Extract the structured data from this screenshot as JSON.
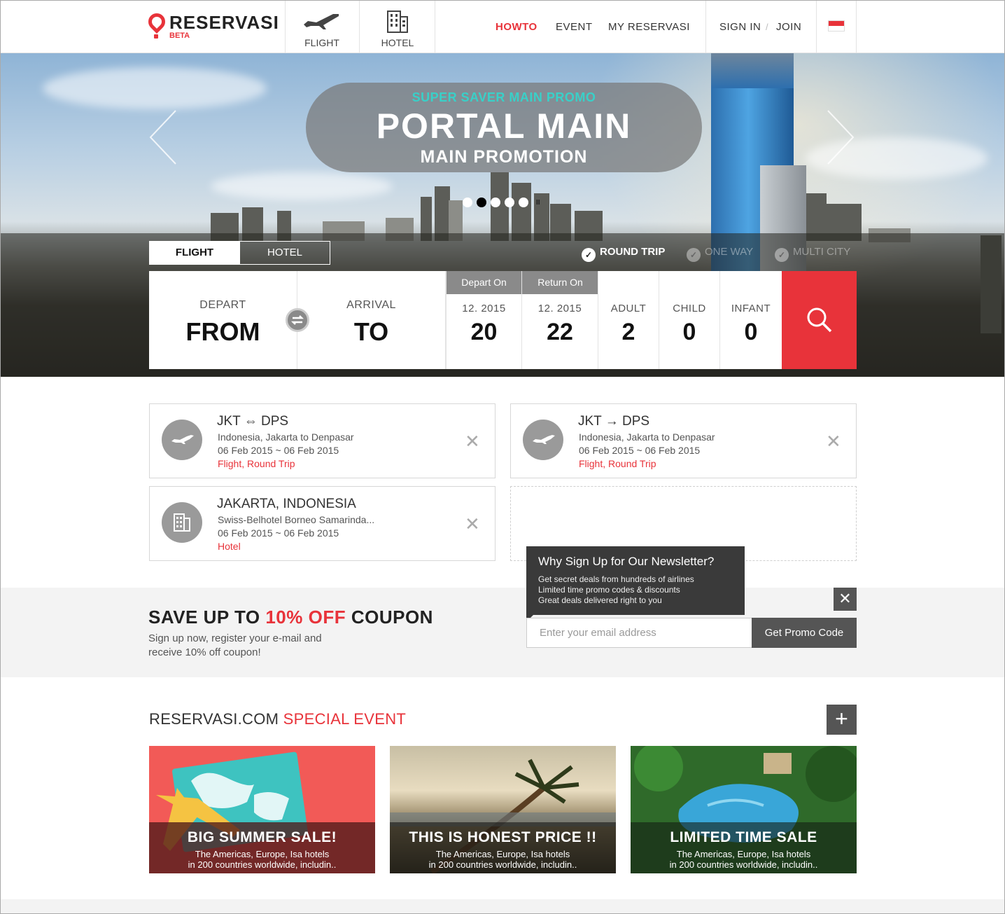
{
  "brand": {
    "name": "RESERVASI",
    "tag": "BETA"
  },
  "modes": [
    {
      "label": "FLIGHT",
      "icon": "airplane-icon"
    },
    {
      "label": "HOTEL",
      "icon": "building-icon"
    }
  ],
  "nav": {
    "howto": "HOWTO",
    "event": "EVENT",
    "my": "MY RESERVASI",
    "signin": "SIGN IN",
    "sep": "/",
    "join": "JOIN"
  },
  "hero": {
    "kicker": "SUPER SAVER MAIN PROMO",
    "title": "PORTAL MAIN",
    "subtitle": "MAIN PROMOTION",
    "slides": 5,
    "active_slide": 2
  },
  "search": {
    "tabs": {
      "flight": "FLIGHT",
      "hotel": "HOTEL"
    },
    "trip": {
      "round": "ROUND TRIP",
      "oneway": "ONE WAY",
      "multi": "MULTI CITY"
    },
    "depart_label": "DEPART",
    "depart_value": "FROM",
    "arrival_label": "ARRIVAL",
    "arrival_value": "TO",
    "depart_on": "Depart On",
    "return_on": "Return On",
    "depart_month": "12. 2015",
    "depart_day": "20",
    "return_month": "12. 2015",
    "return_day": "22",
    "adult_label": "ADULT",
    "adult": "2",
    "child_label": "CHILD",
    "child": "0",
    "infant_label": "INFANT",
    "infant": "0"
  },
  "recent": [
    {
      "from": "JKT",
      "to": "DPS",
      "line1": "Indonesia, Jakarta to Denpasar",
      "line2": "06 Feb 2015 ~ 06 Feb 2015",
      "type": "Flight, Round Trip"
    },
    {
      "from": "JKT",
      "to": "DPS",
      "line1": "Indonesia, Jakarta to Denpasar",
      "line2": "06 Feb 2015 ~ 06 Feb 2015",
      "type": "Flight, Round Trip"
    },
    {
      "title": "JAKARTA, INDONESIA",
      "line1": "Swiss-Belhotel Borneo Samarinda...",
      "line2": "06 Feb 2015 ~ 06 Feb 2015",
      "type": "Hotel"
    }
  ],
  "newsletter": {
    "title_a": "SAVE UP TO",
    "title_b": "10% OFF",
    "title_c": "COUPON",
    "desc": "Sign up now, register your e-mail and receive 10% off coupon!",
    "tip_title": "Why Sign Up for Our Newsletter?",
    "tip_1": "Get secret deals from hundreds of airlines",
    "tip_2": "Limited time promo codes & discounts",
    "tip_3": "Great deals delivered right to you",
    "placeholder": "Enter your email address",
    "button": "Get Promo Code"
  },
  "events": {
    "title_a": "RESERVASI.COM",
    "title_b": "SPECIAL EVENT",
    "items": [
      {
        "title": "BIG SUMMER SALE!",
        "l1": "The Americas, Europe, Isa hotels",
        "l2": "in 200 countries worldwide, includin.."
      },
      {
        "title": "THIS IS HONEST PRICE !!",
        "l1": "The Americas, Europe, Isa hotels",
        "l2": "in 200 countries worldwide, includin.."
      },
      {
        "title": "LIMITED TIME SALE",
        "l1": "The Americas, Europe, Isa hotels",
        "l2": "in 200 countries worldwide, includin.."
      }
    ]
  },
  "colors": {
    "accent": "#e8333a",
    "teal": "#39d0c8",
    "dark": "#3a3a3a"
  }
}
